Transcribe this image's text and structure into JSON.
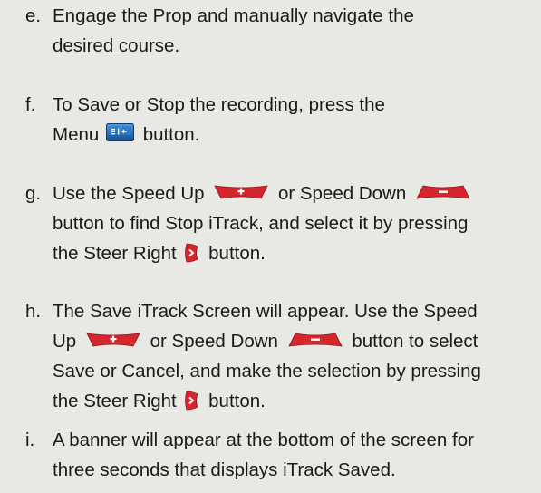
{
  "steps": [
    {
      "letter": "e.",
      "lines": [
        [
          "Engage the Prop and manually navigate the"
        ],
        [
          "desired course."
        ]
      ]
    },
    {
      "letter": "f.",
      "lines": [
        [
          "To Save or Stop the recording, press the"
        ],
        [
          "Menu",
          "button."
        ]
      ]
    },
    {
      "letter": "g.",
      "lines": [
        [
          "Use the Speed Up",
          "or Speed Down",
          ""
        ],
        [
          "button to find Stop iTrack, and select it by pressing"
        ],
        [
          "the Steer Right",
          "button."
        ]
      ]
    },
    {
      "letter": "h.",
      "lines": [
        [
          "The Save iTrack Screen will appear. Use the Speed"
        ],
        [
          "Up",
          "or Speed Down",
          "button to select"
        ],
        [
          "Save or Cancel, and make the selection by pressing"
        ],
        [
          "the Steer Right",
          "button."
        ]
      ]
    },
    {
      "letter": "i.",
      "lines": [
        [
          "A banner will appear at the bottom of the screen for"
        ],
        [
          "three seconds that displays iTrack Saved."
        ]
      ]
    }
  ],
  "colors": {
    "background": "#e8e9e5",
    "text": "#1a1a1a",
    "accent_red": "#d5262e",
    "menu_blue": "#1f6fb5"
  },
  "icons": {
    "menu": "menu-button-icon",
    "speed_up": "speed-up-button-icon",
    "speed_down": "speed-down-button-icon",
    "steer_right": "steer-right-button-icon"
  }
}
